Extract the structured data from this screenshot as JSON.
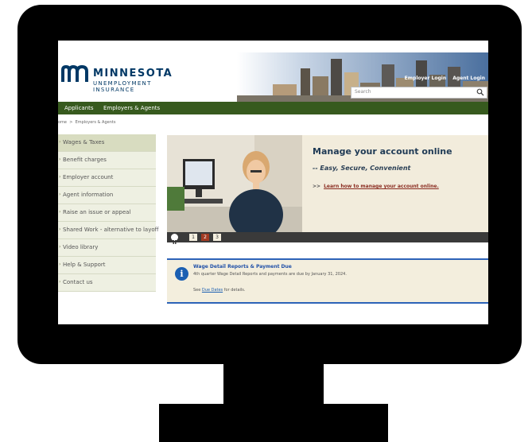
{
  "header": {
    "logo_name": "MINNESOTA",
    "logo_sub": "UNEMPLOYMENT INSURANCE",
    "employer_login": "Employer Login",
    "agent_login": "Agent Login",
    "search_placeholder": "Search"
  },
  "nav": {
    "applicants": "Applicants",
    "employers_agents": "Employers & Agents"
  },
  "breadcrumb": {
    "home": "ome",
    "sep": ">",
    "current": "Employers & Agents"
  },
  "sidebar": {
    "items": [
      {
        "label": "Wages & Taxes"
      },
      {
        "label": "Benefit charges"
      },
      {
        "label": "Employer account"
      },
      {
        "label": "Agent information"
      },
      {
        "label": "Raise an issue or appeal"
      },
      {
        "label": "Shared Work - alternative to layoff"
      },
      {
        "label": "Video library"
      },
      {
        "label": "Help & Support"
      },
      {
        "label": "Contact us"
      }
    ]
  },
  "hero": {
    "title": "Manage your account online",
    "subtitle": "-- Easy, Secure, Convenient",
    "link_arrows": ">>",
    "link_text": "Learn how to manage your account online.",
    "pages": [
      "1",
      "2",
      "3"
    ],
    "active_page": "2"
  },
  "notice": {
    "title": "Wage Detail Reports & Payment Due",
    "body": "4th quarter Wage Detail Reports and payments are due by January 31, 2024.",
    "see": "See",
    "due_dates": "Due Dates",
    "for_details": "for details."
  },
  "colors": {
    "brand_blue": "#003865",
    "nav_green": "#375a1e",
    "accent_red": "#a23a22",
    "notice_blue": "#2d63b8"
  }
}
